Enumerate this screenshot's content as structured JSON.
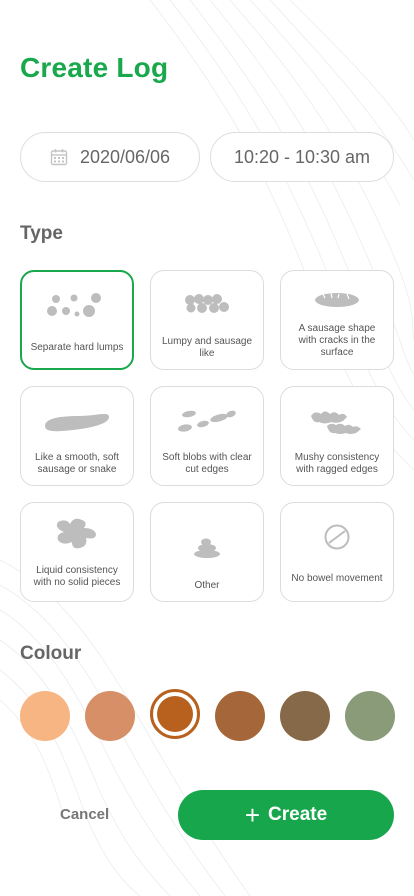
{
  "header": {
    "title": "Create Log"
  },
  "when": {
    "date": "2020/06/06",
    "time": "10:20 - 10:30 am"
  },
  "type_section": {
    "label": "Type",
    "options": [
      {
        "label": "Separate hard lumps",
        "icon": "separate-lumps-icon",
        "selected": true
      },
      {
        "label": "Lumpy and sausage like",
        "icon": "lumpy-sausage-icon",
        "selected": false
      },
      {
        "label": "A sausage shape with cracks in the surface",
        "icon": "cracked-sausage-icon",
        "selected": false
      },
      {
        "label": "Like a smooth, soft sausage or snake",
        "icon": "smooth-sausage-icon",
        "selected": false
      },
      {
        "label": "Soft blobs with clear cut edges",
        "icon": "soft-blobs-icon",
        "selected": false
      },
      {
        "label": "Mushy consistency with ragged edges",
        "icon": "mushy-icon",
        "selected": false
      },
      {
        "label": "Liquid consistency with no solid pieces",
        "icon": "liquid-icon",
        "selected": false
      },
      {
        "label": "Other",
        "icon": "other-icon",
        "selected": false
      },
      {
        "label": "No bowel movement",
        "icon": "no-entry-icon",
        "selected": false
      }
    ]
  },
  "colour_section": {
    "label": "Colour",
    "swatches": [
      {
        "name": "light-orange",
        "color": "#f6b582",
        "selected": false
      },
      {
        "name": "tan",
        "color": "#d68f67",
        "selected": false
      },
      {
        "name": "rust",
        "color": "#b8601d",
        "selected": true
      },
      {
        "name": "brown",
        "color": "#a5673a",
        "selected": false
      },
      {
        "name": "dark-brown",
        "color": "#866948",
        "selected": false
      },
      {
        "name": "sage-green",
        "color": "#8a9b79",
        "selected": false
      }
    ]
  },
  "actions": {
    "cancel_label": "Cancel",
    "create_label": "Create"
  },
  "theme": {
    "accent": "#19a84c",
    "card_border": "#dcdcdc",
    "icon_grey": "#bdbdbd"
  }
}
